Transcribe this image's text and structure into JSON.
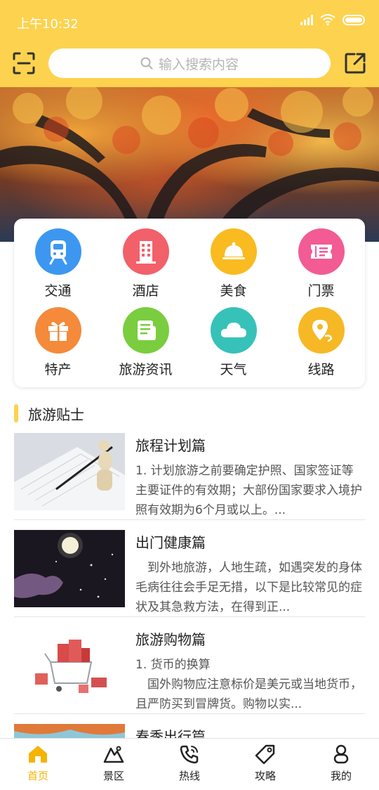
{
  "status_bar": {
    "time": "上午10:32"
  },
  "header": {
    "search_placeholder": "输入搜索内容"
  },
  "grid": [
    {
      "label": "交通",
      "icon": "train-icon",
      "color": "#3d97f0"
    },
    {
      "label": "酒店",
      "icon": "hotel-icon",
      "color": "#f2606a"
    },
    {
      "label": "美食",
      "icon": "food-cover-icon",
      "color": "#f9bb20"
    },
    {
      "label": "门票",
      "icon": "ticket-icon",
      "color": "#f25b94"
    },
    {
      "label": "特产",
      "icon": "gift-icon",
      "color": "#f48a3a"
    },
    {
      "label": "旅游资讯",
      "icon": "news-icon",
      "color": "#7acd3e"
    },
    {
      "label": "天气",
      "icon": "cloud-icon",
      "color": "#36c2b8"
    },
    {
      "label": "线路",
      "icon": "route-pin-icon",
      "color": "#f6b824"
    }
  ],
  "tips_section": {
    "title": "旅游贴士"
  },
  "articles": [
    {
      "title": "旅程计划篇",
      "desc": "1. 计划旅游之前要确定护照、国家签证等主要证件的有效期；大部份国家要求入境护照有效期为6个月或以上。..."
    },
    {
      "title": "出门健康篇",
      "desc": "　到外地旅游，人地生疏，如遇突发的身体毛病往往会手足无措，以下是比较常见的症状及其急救方法，在得到正..."
    },
    {
      "title": "旅游购物篇",
      "desc": "1. 货币的换算\n　国外购物应注意标价是美元或当地货币，且严防买到冒牌货。购物以实..."
    },
    {
      "title": "春季出行篇",
      "desc": ""
    }
  ],
  "tabbar": [
    {
      "label": "首页",
      "icon": "home-icon",
      "active": true
    },
    {
      "label": "景区",
      "icon": "mountain-icon",
      "active": false
    },
    {
      "label": "热线",
      "icon": "phone-icon",
      "active": false
    },
    {
      "label": "攻略",
      "icon": "tag-icon",
      "active": false
    },
    {
      "label": "我的",
      "icon": "user-icon",
      "active": false
    }
  ],
  "colors": {
    "accent": "#fdd24e",
    "tab_active": "#f5b400"
  }
}
